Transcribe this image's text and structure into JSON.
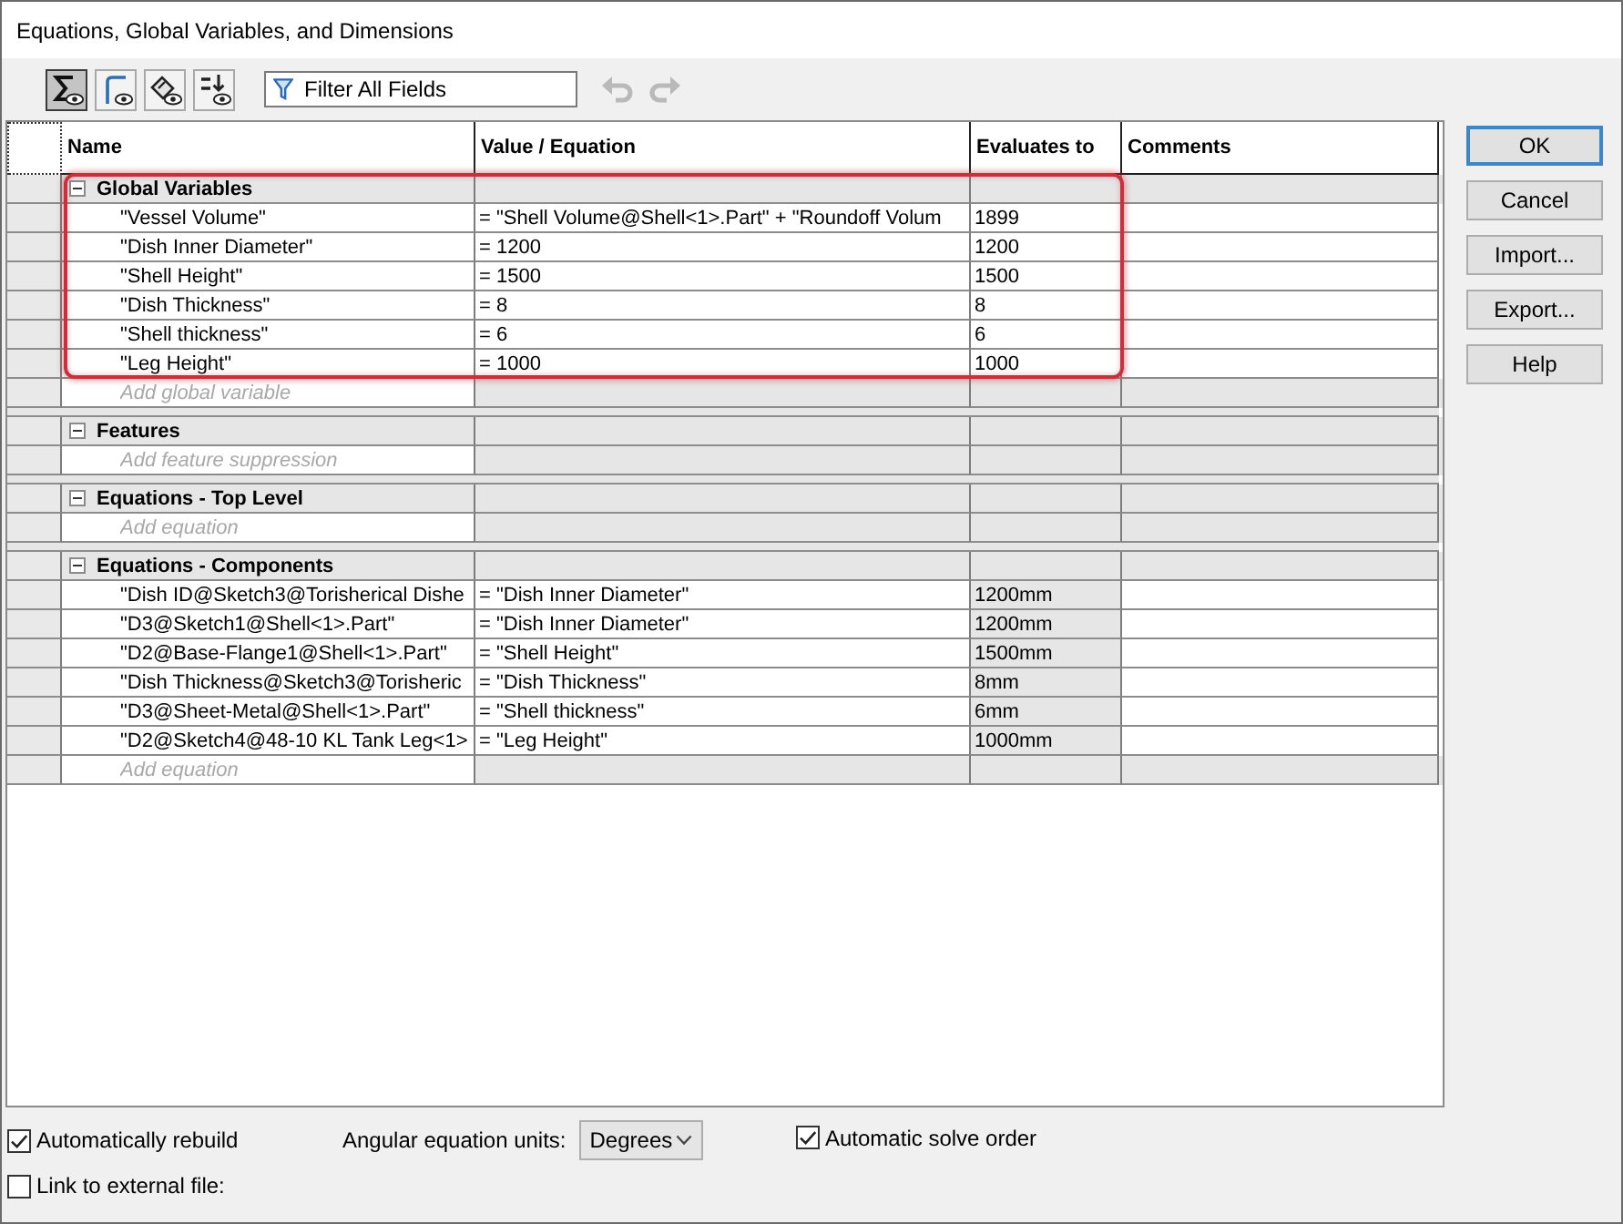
{
  "window": {
    "title": "Equations, Global Variables, and Dimensions"
  },
  "toolbar": {
    "views": [
      {
        "kind": "equations",
        "selected": true
      },
      {
        "kind": "sketch",
        "selected": false
      },
      {
        "kind": "feature",
        "selected": false
      },
      {
        "kind": "order",
        "selected": false
      }
    ],
    "filter": {
      "placeholder": "Filter All Fields"
    },
    "undo": {
      "disabled": true
    },
    "redo": {
      "disabled": true
    }
  },
  "table": {
    "columns": [
      "Name",
      "Value / Equation",
      "Evaluates to",
      "Comments"
    ],
    "groups": [
      {
        "title": "Global Variables",
        "expanded": true,
        "highlighted": true,
        "results_readonly": false,
        "rows": [
          {
            "name": "\"Vessel Volume\"",
            "value": "= \"Shell Volume@Shell<1>.Part\" + \"Roundoff Volum",
            "result": "1899"
          },
          {
            "name": "\"Dish Inner Diameter\"",
            "value": "= 1200",
            "result": "1200"
          },
          {
            "name": "\"Shell Height\"",
            "value": "= 1500",
            "result": "1500"
          },
          {
            "name": "\"Dish Thickness\"",
            "value": "= 8",
            "result": "8"
          },
          {
            "name": "\"Shell thickness\"",
            "value": "= 6",
            "result": "6"
          },
          {
            "name": "\"Leg Height\"",
            "value": "= 1000",
            "result": "1000"
          }
        ],
        "add_field": {
          "placeholder": "Add global variable"
        }
      },
      {
        "title": "Features",
        "expanded": true,
        "highlighted": false,
        "add_field": {
          "placeholder": "Add feature suppression"
        }
      },
      {
        "title": "Equations - Top Level",
        "expanded": true,
        "highlighted": false,
        "add_field": {
          "placeholder": "Add equation"
        }
      },
      {
        "title": "Equations - Components",
        "expanded": true,
        "highlighted": false,
        "results_readonly": true,
        "rows": [
          {
            "name": "\"Dish ID@Sketch3@Torisherical Dishe",
            "value": "= \"Dish Inner Diameter\"",
            "result": "1200mm"
          },
          {
            "name": "\"D3@Sketch1@Shell<1>.Part\"",
            "value": "= \"Dish Inner Diameter\"",
            "result": "1200mm"
          },
          {
            "name": "\"D2@Base-Flange1@Shell<1>.Part\"",
            "value": "= \"Shell Height\"",
            "result": "1500mm"
          },
          {
            "name": "\"Dish Thickness@Sketch3@Torisheric",
            "value": "= \"Dish Thickness\"",
            "result": "8mm"
          },
          {
            "name": "\"D3@Sheet-Metal@Shell<1>.Part\"",
            "value": "= \"Shell thickness\"",
            "result": "6mm"
          },
          {
            "name": "\"D2@Sketch4@48-10 KL Tank Leg<1>",
            "value": "= \"Leg Height\"",
            "result": "1000mm"
          }
        ],
        "add_field": {
          "placeholder": "Add equation"
        }
      }
    ]
  },
  "buttons": [
    {
      "label": "OK",
      "default": true
    },
    {
      "label": "Cancel",
      "default": false
    },
    {
      "label": "Import...",
      "default": false
    },
    {
      "label": "Export...",
      "default": false
    },
    {
      "label": "Help",
      "default": false
    }
  ],
  "options": {
    "auto_rebuild": {
      "label": "Automatically rebuild",
      "checked": true
    },
    "angular_units": {
      "label": "Angular equation units:",
      "value": "Degrees"
    },
    "auto_solve_order": {
      "label": "Automatic solve order",
      "checked": true
    },
    "link_external": {
      "label": "Link to external file:",
      "checked": false
    }
  }
}
